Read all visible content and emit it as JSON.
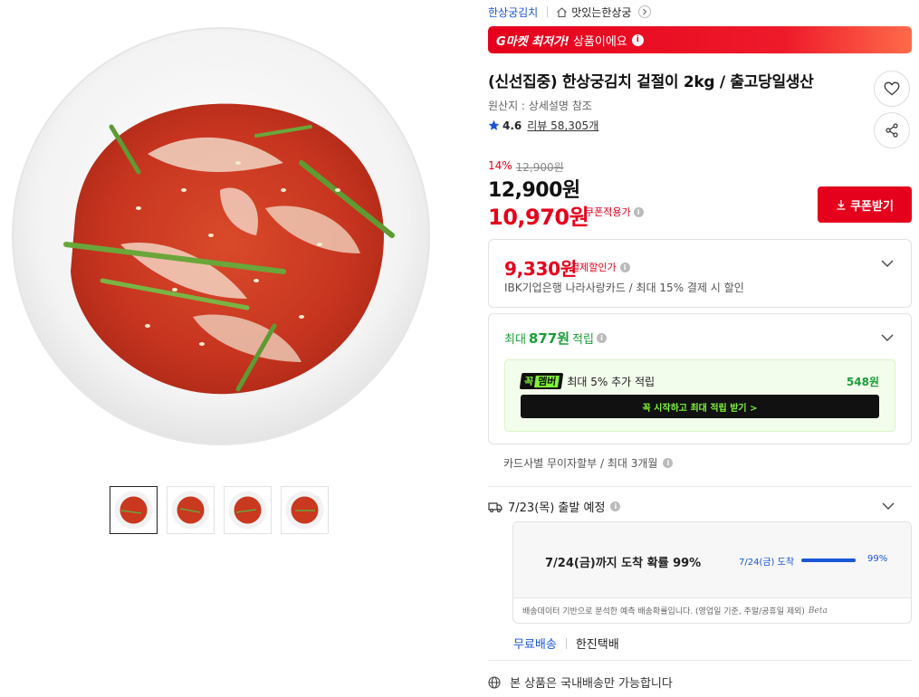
{
  "breadcrumb": {
    "brand": "한상궁김치",
    "store": "맛있는한상궁"
  },
  "banner": {
    "strong": "G마켓 최저가!",
    "rest": "상품이에요"
  },
  "product": {
    "title": "(신선집중) 한상궁김치 겉절이 2kg / 출고당일생산",
    "origin": "원산지 : 상세설명 참조",
    "rating": "4.6",
    "review_label": "리뷰 58,305개"
  },
  "price": {
    "discount_rate": "14%",
    "original": "12,900원",
    "current": "12,900원",
    "coupon_price": "10,970원",
    "coupon_note": "쿠폰적용가",
    "coupon_button": "쿠폰받기"
  },
  "card_discount": {
    "price": "9,330원",
    "tag": "결제할인가",
    "desc": "IBK기업은행 나라사랑카드 / 최대 15% 결제 시 할인"
  },
  "points": {
    "prefix": "최대",
    "amount": "877원",
    "suffix": "적립",
    "member_logo": "꼭",
    "member_logo_tail": "멤버",
    "member_text": "최대 5% 추가 적립",
    "member_amount": "548원",
    "member_cta": "꼭 시작하고 최대 적립 받기 >"
  },
  "installment": "카드사별 무이자할부 / 최대 3개월",
  "shipping": {
    "departure": "7/23(목) 출발 예정",
    "probability": "7/24(금)까지 도착 확률 99%",
    "day": "7/24(금) 도착",
    "percent": "99%",
    "percent_value": 0.99,
    "note": "배송데이터 기반으로 분석한 예측 배송확률입니다. (영업일 기준, 주말/공휴일 제외)",
    "beta": "Beta",
    "free": "무료배송",
    "carrier": "한진택배"
  },
  "domestic": "본 상품은 국내배송만 가능합니다",
  "colors": {
    "accent": "#e5001c",
    "blue": "#1a56d6",
    "green": "#1a9e3a"
  }
}
